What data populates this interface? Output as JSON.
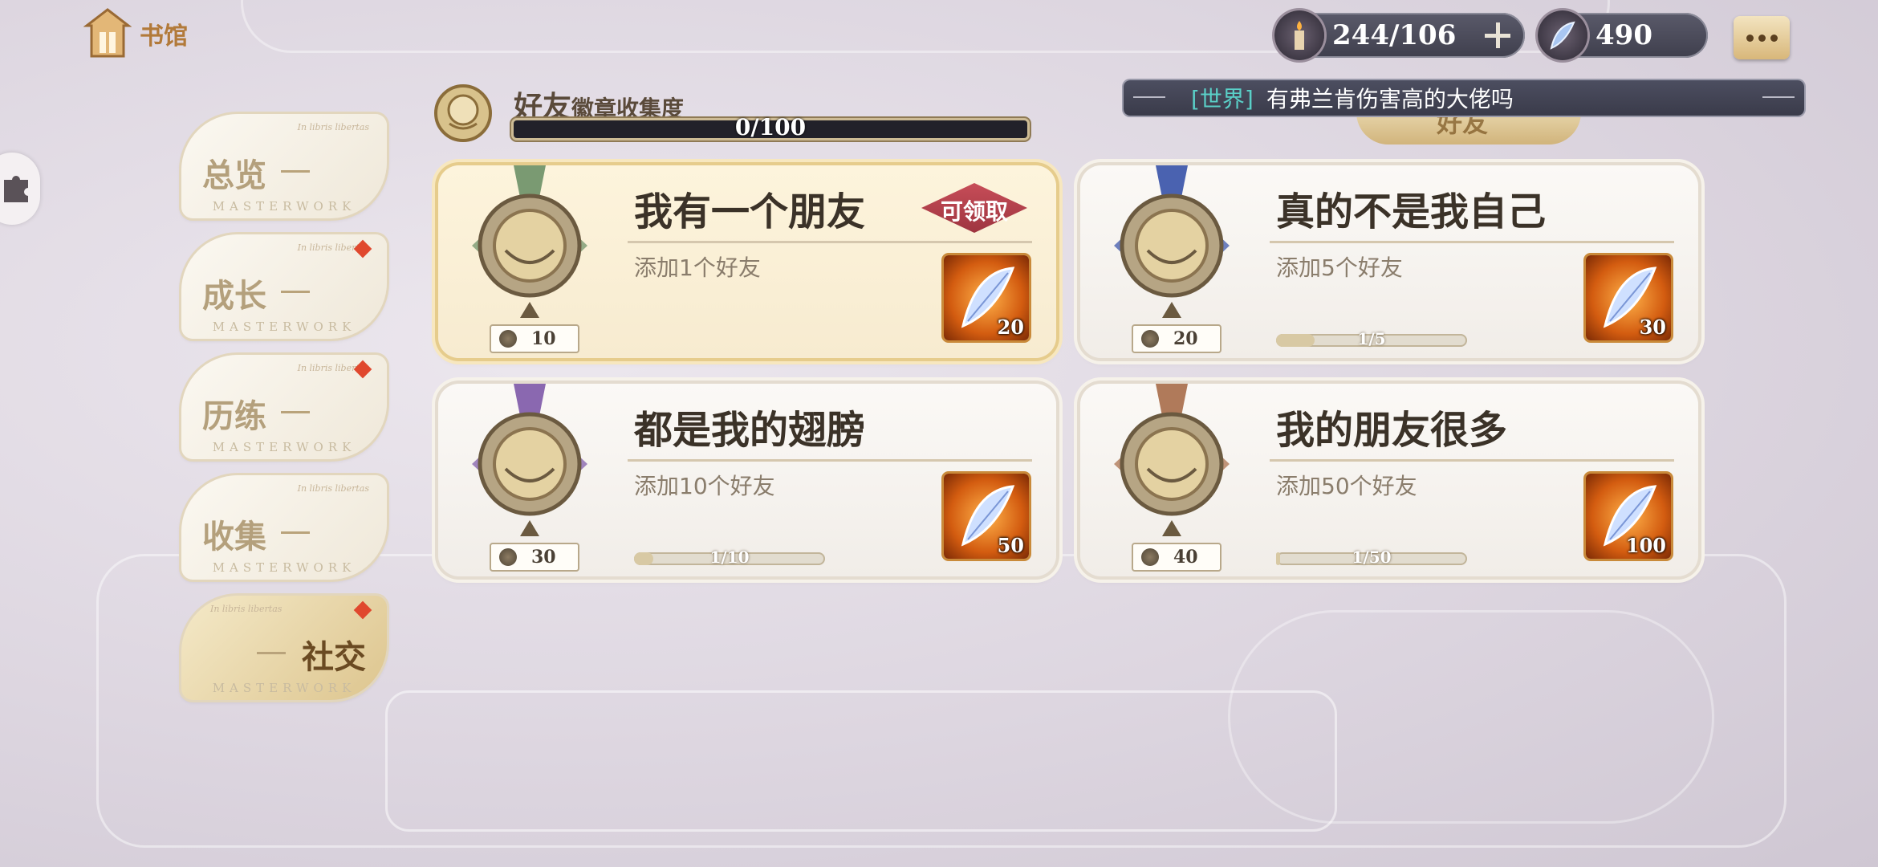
{
  "header": {
    "home_label": "书馆",
    "resources": [
      {
        "icon": "candle-icon",
        "value": "244/106"
      },
      {
        "icon": "feather-crystal-icon",
        "value": "490"
      }
    ],
    "chat_icon": "chat-bubble-icon"
  },
  "world_chat": {
    "channel": "[世界]",
    "message": "有弗兰肯伤害高的大佬吗"
  },
  "section": {
    "title": "好友",
    "subtitle": "徽章收集度",
    "progress_text": "0/100",
    "progress_fraction": 0,
    "hidden_tab_label": "好友"
  },
  "menu": [
    {
      "label": "总览",
      "sub": "MASTERWORK",
      "tag": "In libris libertas",
      "red_dot": false,
      "active": false
    },
    {
      "label": "成长",
      "sub": "MASTERWORK",
      "tag": "In libris libertas",
      "red_dot": true,
      "active": false
    },
    {
      "label": "历练",
      "sub": "MASTERWORK",
      "tag": "In libris libertas",
      "red_dot": true,
      "active": false
    },
    {
      "label": "收集",
      "sub": "MASTERWORK",
      "tag": "In libris libertas",
      "red_dot": false,
      "active": false
    },
    {
      "label": "社交",
      "sub": "MASTERWORK",
      "tag": "In libris libertas",
      "red_dot": true,
      "active": true
    }
  ],
  "cards": [
    {
      "title": "我有一个朋友",
      "desc": "添加1个好友",
      "points": "10",
      "reward_qty": "20",
      "ribbon": "#7a9a72",
      "claim_label": "可领取",
      "progress_text": "",
      "progress": null
    },
    {
      "title": "真的不是我自己",
      "desc": "添加5个好友",
      "points": "20",
      "reward_qty": "30",
      "ribbon": "#4a62b0",
      "claim_label": "",
      "progress_text": "1/5",
      "progress": 0.2
    },
    {
      "title": "都是我的翅膀",
      "desc": "添加10个好友",
      "points": "30",
      "reward_qty": "50",
      "ribbon": "#8a68b0",
      "claim_label": "",
      "progress_text": "1/10",
      "progress": 0.1
    },
    {
      "title": "我的朋友很多",
      "desc": "添加50个好友",
      "points": "40",
      "reward_qty": "100",
      "ribbon": "#b07a5a",
      "claim_label": "",
      "progress_text": "1/50",
      "progress": 0.02
    }
  ]
}
